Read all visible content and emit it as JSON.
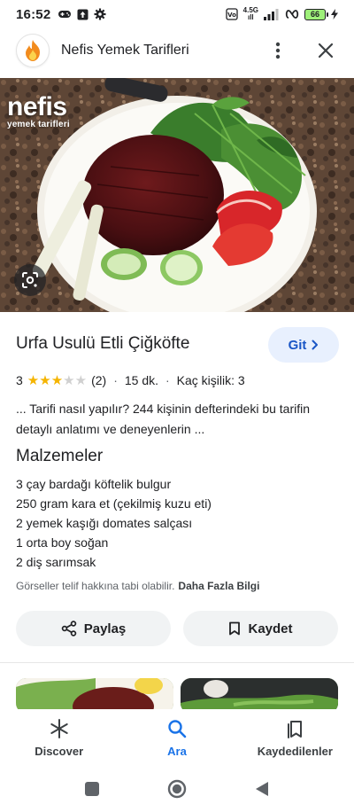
{
  "status_bar": {
    "time": "16:52",
    "network_type_top": "4.5G",
    "network_type_bottom": "ıll",
    "battery_level": "66"
  },
  "header": {
    "site_name": "Nefis Yemek Tarifleri",
    "more_icon": "more-vert-icon",
    "close_icon": "close-icon"
  },
  "hero": {
    "watermark_main": "nefis",
    "watermark_sub": "yemek tarifleri"
  },
  "recipe": {
    "title": "Urfa Usulü Etli Çiğköfte",
    "rating_value": "3",
    "rating_stars_filled": 3,
    "rating_stars_total": 5,
    "rating_count": "(2)",
    "duration": "15 dk.",
    "servings": "Kaç kişilik: 3",
    "description": "... Tarifi nasıl yapılır? 244 kişinin defterindeki bu tarifin detaylı anlatımı ve deneyenlerin ...",
    "go_button": "Git"
  },
  "ingredients": {
    "heading": "Malzemeler",
    "items": [
      "3 çay bardağı köftelik bulgur",
      "250 gram kara et (çekilmiş kuzu eti)",
      "2 yemek kaşığı domates salçası",
      "1 orta boy soğan",
      "2 diş sarımsak"
    ]
  },
  "copyright": {
    "text": "Görseller telif hakkına tabi olabilir.",
    "link": "Daha Fazla Bilgi"
  },
  "actions": {
    "share": "Paylaş",
    "save": "Kaydet"
  },
  "bottom_nav": {
    "items": [
      {
        "label": "Discover",
        "icon": "asterisk-icon",
        "active": false
      },
      {
        "label": "Ara",
        "icon": "search-icon",
        "active": true
      },
      {
        "label": "Kaydedilenler",
        "icon": "collections-icon",
        "active": false
      }
    ]
  },
  "colors": {
    "accent": "#1a73e8",
    "go_button_bg": "#e8f0fe",
    "star_filled": "#f5b400",
    "star_empty": "#d0d0d0",
    "chip_bg": "#f1f3f4"
  }
}
